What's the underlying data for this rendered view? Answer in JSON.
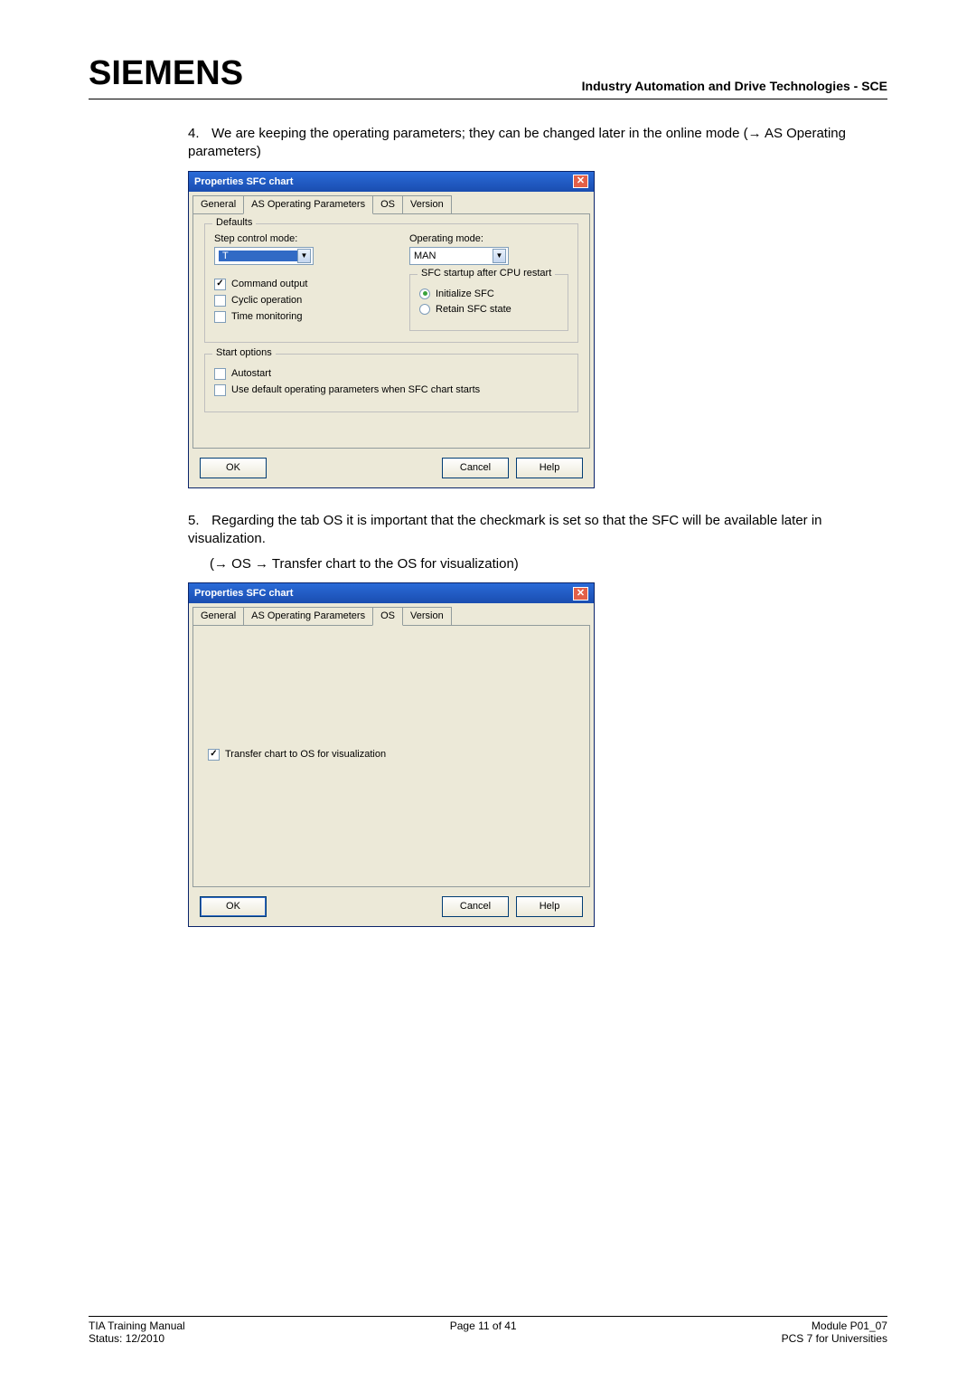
{
  "header": {
    "brand": "SIEMENS",
    "right": "Industry Automation and Drive Technologies - SCE"
  },
  "p4": {
    "num": "4.",
    "text": "We are keeping the operating parameters; they can be changed later in the online mode (→ AS Operating parameters)"
  },
  "p5": {
    "num": "5.",
    "text": "Regarding the tab OS it is important that the checkmark is set so that the SFC will be available later in visualization.",
    "sub": "(→ OS → Transfer chart to the OS for visualization)"
  },
  "dlg": {
    "title": "Properties SFC chart",
    "tabs": {
      "general": "General",
      "asop": "AS Operating Parameters",
      "os": "OS",
      "version": "Version"
    }
  },
  "panel1": {
    "defaults": "Defaults",
    "step_label": "Step control mode:",
    "step_value": "T",
    "op_label": "Operating mode:",
    "op_value": "MAN",
    "chk_cmd": "Command output",
    "chk_cyc": "Cyclic operation",
    "chk_time": "Time monitoring",
    "sfc_group": "SFC startup after CPU restart",
    "r_init": "Initialize SFC",
    "r_retain": "Retain SFC state",
    "startopts": "Start options",
    "chk_auto": "Autostart",
    "chk_usedef": "Use default operating parameters when SFC chart starts"
  },
  "panel2": {
    "chk_transfer": "Transfer chart to OS for visualization"
  },
  "buttons": {
    "ok": "OK",
    "cancel": "Cancel",
    "help": "Help"
  },
  "footer": {
    "l1": "TIA Training Manual",
    "l2": "Status: 12/2010",
    "c1": "Page 11 of 41",
    "r1": "Module P01_07",
    "r2": "PCS 7 for Universities"
  }
}
